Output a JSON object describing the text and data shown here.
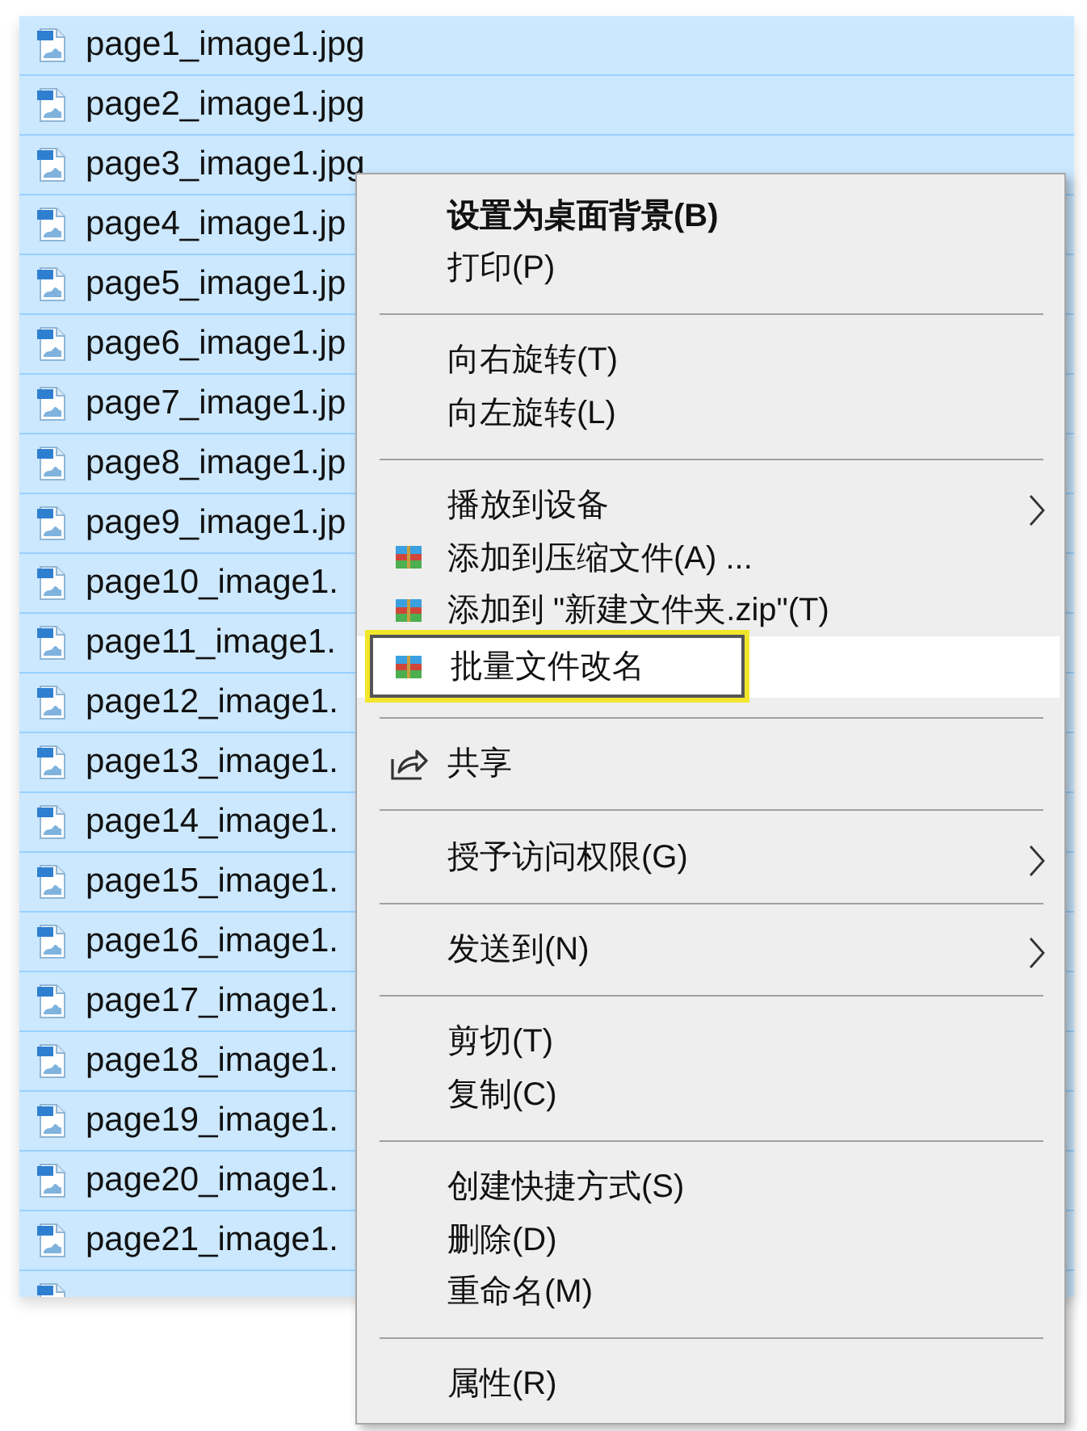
{
  "files": [
    {
      "name": "page1_image1.jpg",
      "selected": true
    },
    {
      "name": "page2_image1.jpg",
      "selected": true
    },
    {
      "name": "page3_image1.jpg",
      "selected": true
    },
    {
      "name": "page4_image1.jp",
      "selected": true
    },
    {
      "name": "page5_image1.jp",
      "selected": true
    },
    {
      "name": "page6_image1.jp",
      "selected": true
    },
    {
      "name": "page7_image1.jp",
      "selected": true
    },
    {
      "name": "page8_image1.jp",
      "selected": true
    },
    {
      "name": "page9_image1.jp",
      "selected": true
    },
    {
      "name": "page10_image1.",
      "selected": true
    },
    {
      "name": "page11_image1.",
      "selected": true
    },
    {
      "name": "page12_image1.",
      "selected": true
    },
    {
      "name": "page13_image1.",
      "selected": true
    },
    {
      "name": "page14_image1.",
      "selected": true
    },
    {
      "name": "page15_image1.",
      "selected": true
    },
    {
      "name": "page16_image1.",
      "selected": true
    },
    {
      "name": "page17_image1.",
      "selected": true
    },
    {
      "name": "page18_image1.",
      "selected": true
    },
    {
      "name": "page19_image1.",
      "selected": true
    },
    {
      "name": "page20_image1.",
      "selected": true
    },
    {
      "name": "page21_image1.",
      "selected": true
    },
    {
      "selected": true
    }
  ],
  "context_menu": [
    {
      "kind": "item",
      "label": "设置为桌面背景(B)",
      "default": true,
      "selected": false
    },
    {
      "kind": "item",
      "label": "打印(P)",
      "selected": false
    },
    {
      "kind": "separator"
    },
    {
      "kind": "item",
      "label": "向右旋转(T)",
      "selected": false
    },
    {
      "kind": "item",
      "label": "向左旋转(L)",
      "selected": false
    },
    {
      "kind": "separator"
    },
    {
      "kind": "item",
      "label": "播放到设备",
      "submenu": true,
      "selected": false
    },
    {
      "kind": "archive",
      "label": "添加到压缩文件(A) ...",
      "selected": false
    },
    {
      "kind": "archive",
      "label": "添加到 \"新建文件夹.zip\"(T)",
      "selected": false
    },
    {
      "kind": "archive",
      "label": "批量文件改名",
      "selected": true
    },
    {
      "kind": "separator"
    },
    {
      "kind": "share",
      "label": "共享",
      "selected": false
    },
    {
      "kind": "separator"
    },
    {
      "kind": "item",
      "label": "授予访问权限(G)",
      "submenu": true,
      "selected": false
    },
    {
      "kind": "separator"
    },
    {
      "kind": "item",
      "label": "发送到(N)",
      "submenu": true,
      "selected": false
    },
    {
      "kind": "separator"
    },
    {
      "kind": "item",
      "label": "剪切(T)",
      "selected": false
    },
    {
      "kind": "item",
      "label": "复制(C)",
      "selected": false
    },
    {
      "kind": "separator"
    },
    {
      "kind": "item",
      "label": "创建快捷方式(S)",
      "selected": false
    },
    {
      "kind": "item",
      "label": "删除(D)",
      "selected": false
    },
    {
      "kind": "item",
      "label": "重命名(M)",
      "selected": false
    },
    {
      "kind": "separator"
    },
    {
      "kind": "item",
      "label": "属性(R)",
      "selected": false
    }
  ]
}
